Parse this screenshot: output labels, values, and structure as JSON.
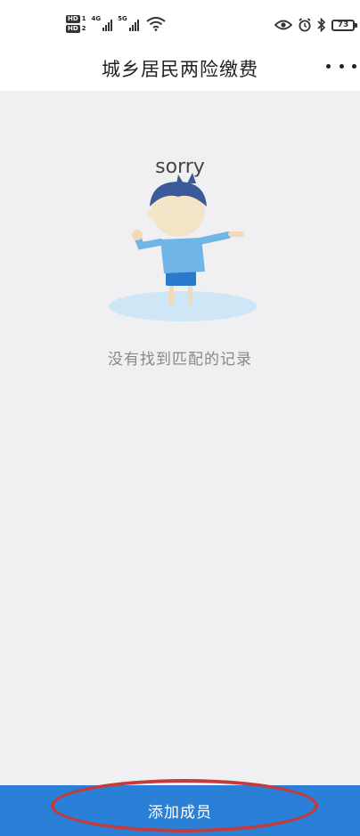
{
  "status_bar": {
    "hd1": "HD",
    "sim1": "1",
    "hd2": "HD",
    "sim2": "2",
    "signal1_gen": "4G",
    "signal2_gen": "5G",
    "battery": "73",
    "icons": [
      "eye-icon",
      "alarm-icon",
      "bluetooth-icon"
    ]
  },
  "nav": {
    "title": "城乡居民两险缴费",
    "more_icon": "more-dots-icon"
  },
  "empty_state": {
    "sorry_text": "sorry",
    "message": "没有找到匹配的记录"
  },
  "bottom": {
    "add_member_label": "添加成员"
  },
  "colors": {
    "accent": "#2a7fd6",
    "background": "#f0f0f2",
    "highlight": "#c53a3a",
    "shirt": "#6fb6e6",
    "hair": "#3a5a99"
  }
}
